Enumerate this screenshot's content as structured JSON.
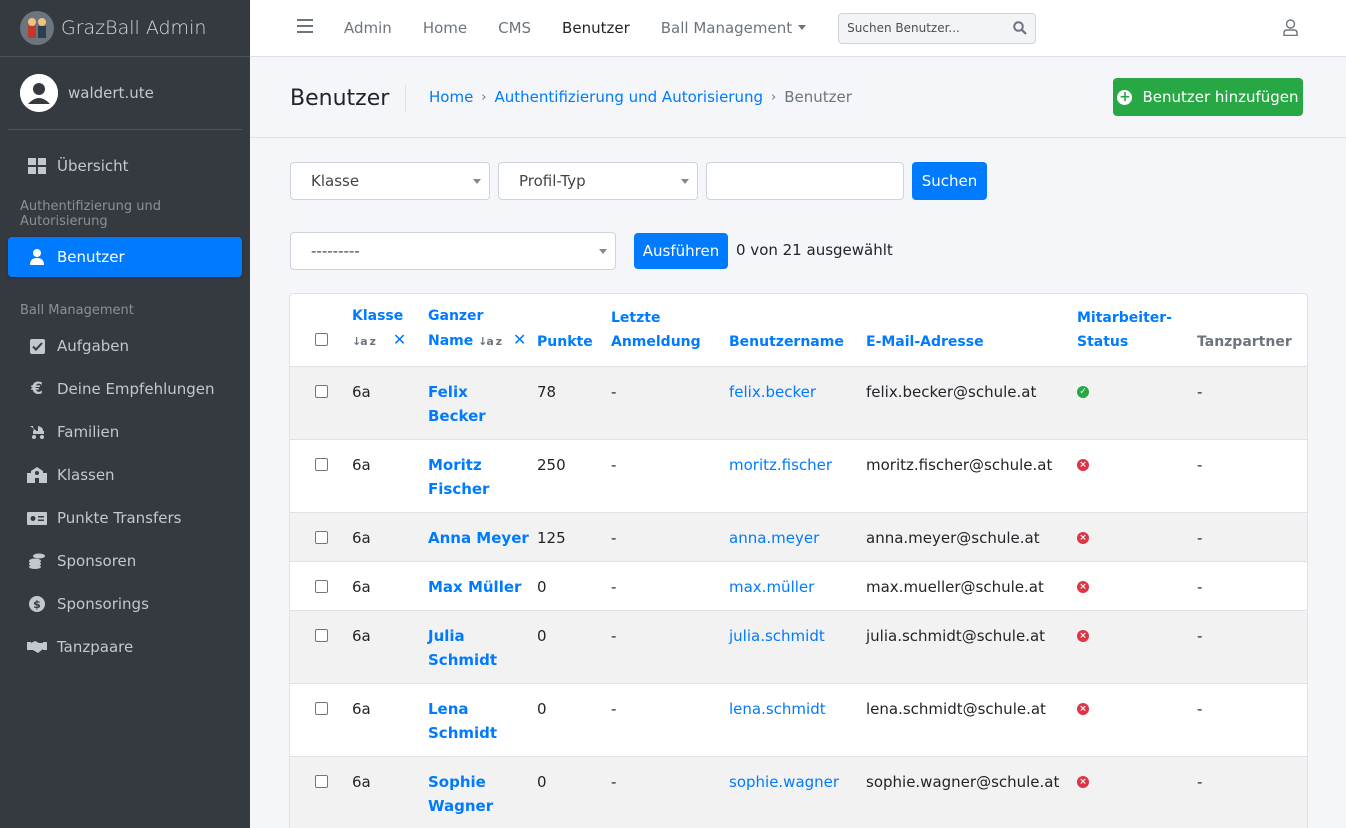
{
  "brand": {
    "title": "GrazBall Admin"
  },
  "user": {
    "name": "waldert.ute"
  },
  "sidebar": {
    "overview": {
      "label": "Übersicht",
      "icon": "dashboard-grid-icon"
    },
    "auth_header": "Authentifizierung und Autorisierung",
    "users": {
      "label": "Benutzer",
      "icon": "user-icon"
    },
    "ball_header": "Ball Management",
    "items": [
      {
        "label": "Aufgaben",
        "icon": "checkbox-icon"
      },
      {
        "label": "Deine Empfehlungen",
        "icon": "euro-icon"
      },
      {
        "label": "Familien",
        "icon": "stroller-icon"
      },
      {
        "label": "Klassen",
        "icon": "school-icon"
      },
      {
        "label": "Punkte Transfers",
        "icon": "money-bill-icon"
      },
      {
        "label": "Sponsoren",
        "icon": "coins-icon"
      },
      {
        "label": "Sponsorings",
        "icon": "donate-icon"
      },
      {
        "label": "Tanzpaare",
        "icon": "handshake-icon"
      }
    ]
  },
  "topnav": {
    "links": [
      "Admin",
      "Home",
      "CMS",
      "Benutzer"
    ],
    "dropdown": "Ball Management",
    "search_placeholder": "Suchen Benutzer..."
  },
  "header": {
    "title": "Benutzer",
    "breadcrumb": [
      "Home",
      "Authentifizierung und Autorisierung",
      "Benutzer"
    ],
    "add_button": "Benutzer hinzufügen"
  },
  "filters": {
    "class_select": "Klasse",
    "profile_select": "Profil-Typ",
    "search_value": "",
    "search_button": "Suchen"
  },
  "actions": {
    "action_select": "---------",
    "run_button": "Ausführen",
    "selection_count": "0 von 21 ausgewählt"
  },
  "table": {
    "headers": {
      "klasse": "Klasse",
      "name_1": "Ganzer",
      "name_2": "Name",
      "punkte": "Punkte",
      "last_1": "Letzte",
      "last_2": "Anmeldung",
      "username": "Benutzername",
      "email": "E-Mail-Adresse",
      "staff_1": "Mitarbeiter-",
      "staff_2": "Status",
      "partner": "Tanzpartner"
    },
    "rows": [
      {
        "klasse": "6a",
        "name1": "Felix",
        "name2": "Becker",
        "punkte": "78",
        "last": "-",
        "username": "felix.becker",
        "email": "felix.becker@schule.at",
        "staff": true,
        "partner": "-"
      },
      {
        "klasse": "6a",
        "name1": "Moritz",
        "name2": "Fischer",
        "punkte": "250",
        "last": "-",
        "username": "moritz.fischer",
        "email": "moritz.fischer@schule.at",
        "staff": false,
        "partner": "-"
      },
      {
        "klasse": "6a",
        "name1": "Anna Meyer",
        "name2": "",
        "punkte": "125",
        "last": "-",
        "username": "anna.meyer",
        "email": "anna.meyer@schule.at",
        "staff": false,
        "partner": "-"
      },
      {
        "klasse": "6a",
        "name1": "Max Müller",
        "name2": "",
        "punkte": "0",
        "last": "-",
        "username": "max.müller",
        "email": "max.mueller@schule.at",
        "staff": false,
        "partner": "-"
      },
      {
        "klasse": "6a",
        "name1": "Julia",
        "name2": "Schmidt",
        "punkte": "0",
        "last": "-",
        "username": "julia.schmidt",
        "email": "julia.schmidt@schule.at",
        "staff": false,
        "partner": "-"
      },
      {
        "klasse": "6a",
        "name1": "Lena",
        "name2": "Schmidt",
        "punkte": "0",
        "last": "-",
        "username": "lena.schmidt",
        "email": "lena.schmidt@schule.at",
        "staff": false,
        "partner": "-"
      },
      {
        "klasse": "6a",
        "name1": "Sophie",
        "name2": "Wagner",
        "punkte": "0",
        "last": "-",
        "username": "sophie.wagner",
        "email": "sophie.wagner@schule.at",
        "staff": false,
        "partner": "-"
      }
    ]
  },
  "colors": {
    "sidebar": "#343a40",
    "primary": "#007bff",
    "success": "#28a745",
    "danger": "#dc3545"
  }
}
